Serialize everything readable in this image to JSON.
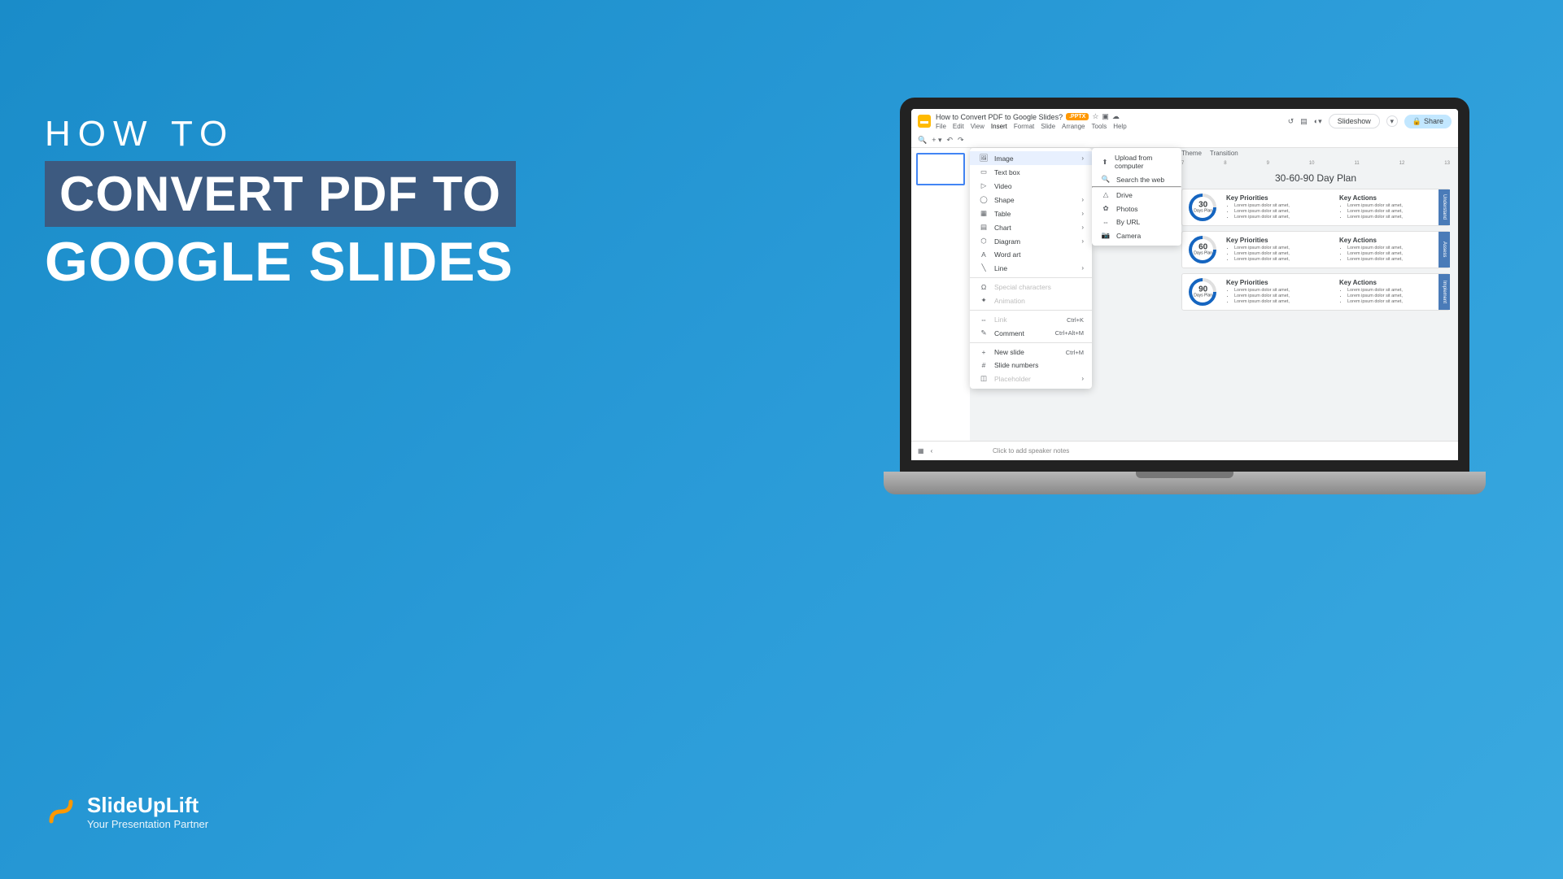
{
  "hero": {
    "line1": "HOW TO",
    "line2": "CONVERT PDF TO",
    "line3": "GOOGLE SLIDES"
  },
  "brand": {
    "name": "SlideUpLift",
    "tag": "Your Presentation Partner"
  },
  "gs": {
    "doc_title": "How to Convert PDF to Google Slides?",
    "pptx_badge": ".PPTX",
    "menu": [
      "File",
      "Edit",
      "View",
      "Insert",
      "Format",
      "Slide",
      "Arrange",
      "Tools",
      "Help"
    ],
    "active_menu": "Insert",
    "slideshow": "Slideshow",
    "share": "Share",
    "ruler_tabs": [
      "Theme",
      "Transition"
    ],
    "speaker_notes": "Click to add speaker notes"
  },
  "dropdown": {
    "group1": [
      {
        "icon": "🖼",
        "label": "Image",
        "arrow": true,
        "hl": true
      },
      {
        "icon": "▭",
        "label": "Text box"
      },
      {
        "icon": "▷",
        "label": "Video"
      },
      {
        "icon": "◯",
        "label": "Shape",
        "arrow": true
      },
      {
        "icon": "▦",
        "label": "Table",
        "arrow": true
      },
      {
        "icon": "▤",
        "label": "Chart",
        "arrow": true
      },
      {
        "icon": "⬡",
        "label": "Diagram",
        "arrow": true
      },
      {
        "icon": "A",
        "label": "Word art"
      },
      {
        "icon": "╲",
        "label": "Line",
        "arrow": true
      }
    ],
    "group2": [
      {
        "icon": "Ω",
        "label": "Special characters",
        "dim": true
      },
      {
        "icon": "✦",
        "label": "Animation",
        "dim": true
      }
    ],
    "group3": [
      {
        "icon": "⇔",
        "label": "Link",
        "shortcut": "Ctrl+K",
        "dim": true
      },
      {
        "icon": "✎",
        "label": "Comment",
        "shortcut": "Ctrl+Alt+M"
      }
    ],
    "group4": [
      {
        "icon": "+",
        "label": "New slide",
        "shortcut": "Ctrl+M"
      },
      {
        "icon": "#",
        "label": "Slide numbers"
      },
      {
        "icon": "◫",
        "label": "Placeholder",
        "arrow": true,
        "dim": true
      }
    ]
  },
  "submenu": [
    {
      "icon": "⬆",
      "label": "Upload from computer"
    },
    {
      "icon": "🔍",
      "label": "Search the web"
    },
    {
      "icon": "△",
      "label": "Drive",
      "sep_before": true
    },
    {
      "icon": "✿",
      "label": "Photos"
    },
    {
      "icon": "⇔",
      "label": "By URL"
    },
    {
      "icon": "📷",
      "label": "Camera"
    }
  ],
  "slide": {
    "title": "30-60-90 Day Plan",
    "plans": [
      {
        "num": "30",
        "lbl": "Days Plan",
        "tab": "Understand",
        "col1_title": "Key Priorities",
        "col2_title": "Key Actions"
      },
      {
        "num": "60",
        "lbl": "Days Plan",
        "tab": "Assess",
        "col1_title": "Key Priorities",
        "col2_title": "Key Actions"
      },
      {
        "num": "90",
        "lbl": "Days Plan",
        "tab": "Implement",
        "col1_title": "Key Priorities",
        "col2_title": "Key Actions"
      }
    ],
    "bullet": "Lorem ipsum dolor sit amet,"
  }
}
